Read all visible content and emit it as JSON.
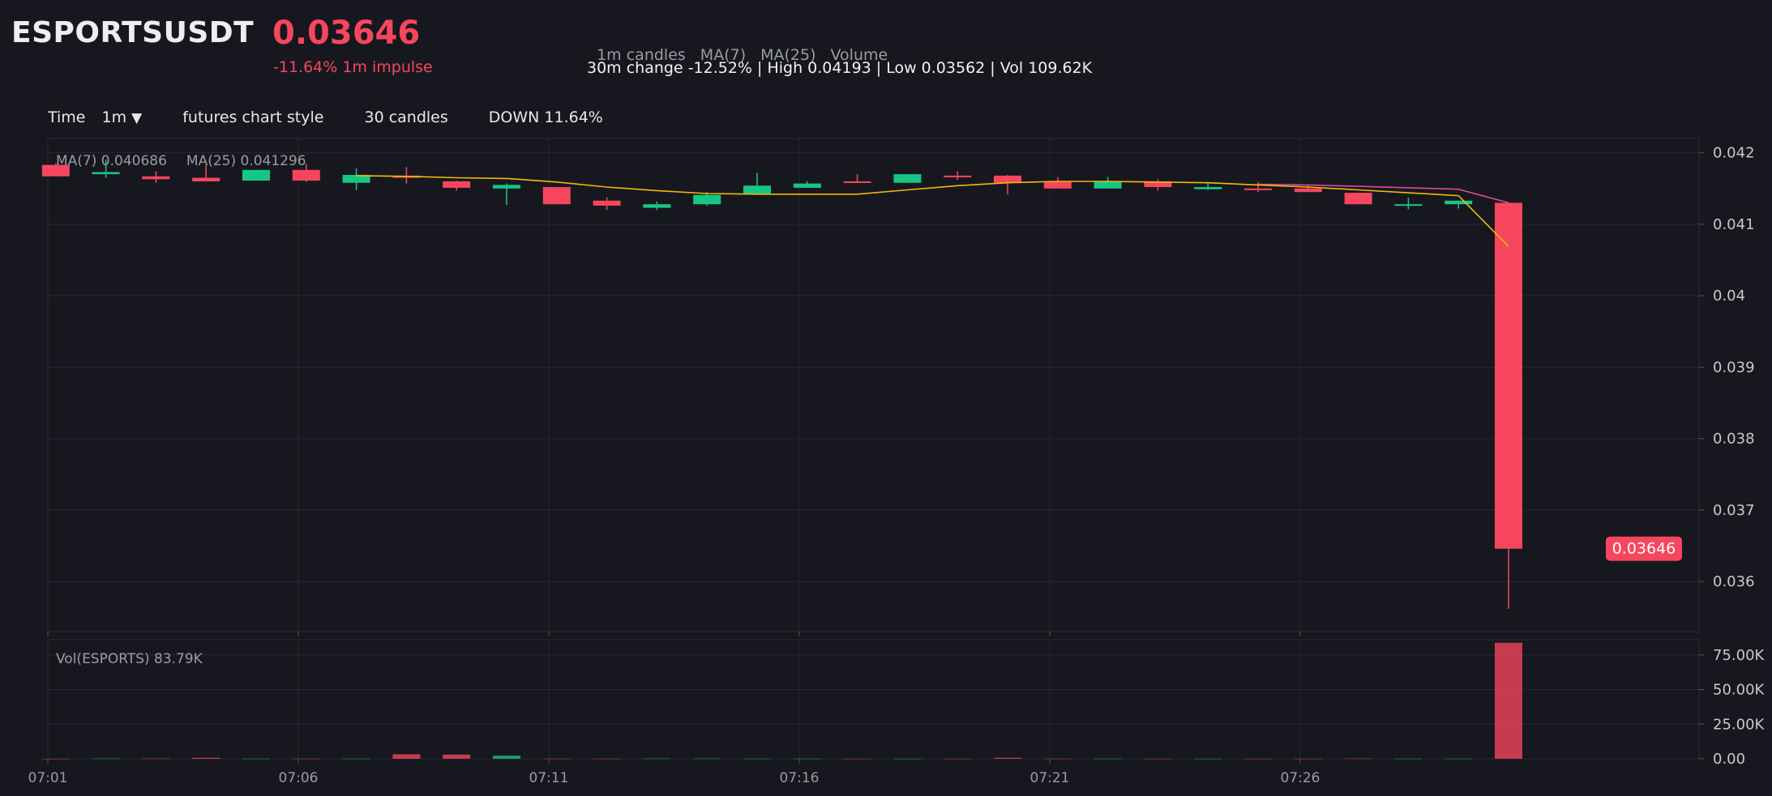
{
  "header": {
    "symbol": "ESPORTSUSDT",
    "price": "0.03646",
    "impulse": "-11.64% 1m impulse",
    "indicators": [
      "1m candles",
      "MA(7)",
      "MA(25)",
      "Volume"
    ],
    "summary": "30m change -12.52% | High 0.04193 | Low 0.03562 | Vol 109.62K"
  },
  "toolbar": {
    "time_label": "Time",
    "interval": "1m",
    "dropdown_glyph": "▼",
    "style_label": "futures chart style",
    "candles_label": "30 candles",
    "direction_label": "DOWN 11.64%"
  },
  "colors": {
    "up": "#16c784",
    "down": "#f6465d",
    "ma7": "#f0b90b",
    "ma25": "#e0489a",
    "background": "#17181f",
    "grid": "#262832",
    "text_muted": "#9a9ca3"
  },
  "chart_data": [
    {
      "type": "candlestick",
      "title": "",
      "legend": [
        {
          "name": "MA(7)",
          "value": "0.040686"
        },
        {
          "name": "MA(25)",
          "value": "0.041296"
        }
      ],
      "x_ticks": [
        "07:01",
        "07:06",
        "07:11",
        "07:16",
        "07:21",
        "07:26"
      ],
      "ylim": [
        0.0353,
        0.0422
      ],
      "y_ticks": [
        "0.036",
        "0.037",
        "0.038",
        "0.039",
        "0.04",
        "0.041",
        "0.042"
      ],
      "last_price_label": "0.03646",
      "grid": true,
      "candles": [
        {
          "t": "07:01",
          "o": 0.04183,
          "h": 0.04185,
          "l": 0.04167,
          "c": 0.04167
        },
        {
          "t": "07:02",
          "o": 0.0417,
          "h": 0.0419,
          "l": 0.04165,
          "c": 0.04173
        },
        {
          "t": "07:03",
          "o": 0.04167,
          "h": 0.04174,
          "l": 0.04158,
          "c": 0.04163
        },
        {
          "t": "07:04",
          "o": 0.04165,
          "h": 0.04183,
          "l": 0.0416,
          "c": 0.0416
        },
        {
          "t": "07:05",
          "o": 0.04161,
          "h": 0.04176,
          "l": 0.04161,
          "c": 0.04176
        },
        {
          "t": "07:06",
          "o": 0.04176,
          "h": 0.04184,
          "l": 0.04159,
          "c": 0.04161
        },
        {
          "t": "07:07",
          "o": 0.04158,
          "h": 0.04178,
          "l": 0.04148,
          "c": 0.04169
        },
        {
          "t": "07:08",
          "o": 0.04168,
          "h": 0.0418,
          "l": 0.04157,
          "c": 0.04165
        },
        {
          "t": "07:09",
          "o": 0.0416,
          "h": 0.04161,
          "l": 0.04147,
          "c": 0.04151
        },
        {
          "t": "07:10",
          "o": 0.0415,
          "h": 0.04157,
          "l": 0.04127,
          "c": 0.04155
        },
        {
          "t": "07:11",
          "o": 0.04152,
          "h": 0.04152,
          "l": 0.04128,
          "c": 0.04128
        },
        {
          "t": "07:12",
          "o": 0.04133,
          "h": 0.04138,
          "l": 0.0412,
          "c": 0.04126
        },
        {
          "t": "07:13",
          "o": 0.04123,
          "h": 0.04132,
          "l": 0.0412,
          "c": 0.04128
        },
        {
          "t": "07:14",
          "o": 0.04128,
          "h": 0.04145,
          "l": 0.04126,
          "c": 0.04141
        },
        {
          "t": "07:15",
          "o": 0.04142,
          "h": 0.04172,
          "l": 0.04142,
          "c": 0.04154
        },
        {
          "t": "07:16",
          "o": 0.04151,
          "h": 0.0416,
          "l": 0.04151,
          "c": 0.04157
        },
        {
          "t": "07:17",
          "o": 0.0416,
          "h": 0.0417,
          "l": 0.04158,
          "c": 0.04159
        },
        {
          "t": "07:18",
          "o": 0.04158,
          "h": 0.0417,
          "l": 0.04158,
          "c": 0.0417
        },
        {
          "t": "07:19",
          "o": 0.04168,
          "h": 0.04174,
          "l": 0.04162,
          "c": 0.04166
        },
        {
          "t": "07:20",
          "o": 0.04168,
          "h": 0.04169,
          "l": 0.04142,
          "c": 0.04158
        },
        {
          "t": "07:21",
          "o": 0.0416,
          "h": 0.04166,
          "l": 0.0415,
          "c": 0.0415
        },
        {
          "t": "07:22",
          "o": 0.0415,
          "h": 0.04166,
          "l": 0.0415,
          "c": 0.0416
        },
        {
          "t": "07:23",
          "o": 0.0416,
          "h": 0.04163,
          "l": 0.04147,
          "c": 0.04152
        },
        {
          "t": "07:24",
          "o": 0.04149,
          "h": 0.04158,
          "l": 0.04148,
          "c": 0.04152
        },
        {
          "t": "07:25",
          "o": 0.0415,
          "h": 0.04159,
          "l": 0.04145,
          "c": 0.04148
        },
        {
          "t": "07:26",
          "o": 0.0415,
          "h": 0.04154,
          "l": 0.04145,
          "c": 0.04145
        },
        {
          "t": "07:27",
          "o": 0.04144,
          "h": 0.04144,
          "l": 0.04128,
          "c": 0.04128
        },
        {
          "t": "07:28",
          "o": 0.04128,
          "h": 0.04137,
          "l": 0.04121,
          "c": 0.04128
        },
        {
          "t": "07:29",
          "o": 0.04128,
          "h": 0.04133,
          "l": 0.04122,
          "c": 0.04133
        },
        {
          "t": "07:30",
          "o": 0.0413,
          "h": 0.0413,
          "l": 0.03562,
          "c": 0.03646
        }
      ],
      "ma7": [
        {
          "t": "07:07",
          "v": 0.04168
        },
        {
          "t": "07:08",
          "v": 0.04167
        },
        {
          "t": "07:09",
          "v": 0.04165
        },
        {
          "t": "07:10",
          "v": 0.04164
        },
        {
          "t": "07:11",
          "v": 0.04159
        },
        {
          "t": "07:12",
          "v": 0.04152
        },
        {
          "t": "07:13",
          "v": 0.04147
        },
        {
          "t": "07:14",
          "v": 0.04143
        },
        {
          "t": "07:15",
          "v": 0.04142
        },
        {
          "t": "07:16",
          "v": 0.04142
        },
        {
          "t": "07:17",
          "v": 0.04142
        },
        {
          "t": "07:18",
          "v": 0.04148
        },
        {
          "t": "07:19",
          "v": 0.04154
        },
        {
          "t": "07:20",
          "v": 0.04158
        },
        {
          "t": "07:21",
          "v": 0.0416
        },
        {
          "t": "07:22",
          "v": 0.0416
        },
        {
          "t": "07:23",
          "v": 0.04159
        },
        {
          "t": "07:24",
          "v": 0.04158
        },
        {
          "t": "07:25",
          "v": 0.04155
        },
        {
          "t": "07:26",
          "v": 0.04152
        },
        {
          "t": "07:27",
          "v": 0.04148
        },
        {
          "t": "07:28",
          "v": 0.04144
        },
        {
          "t": "07:29",
          "v": 0.0414
        },
        {
          "t": "07:30",
          "v": 0.04069
        }
      ],
      "ma25": [
        {
          "t": "07:25",
          "v": 0.04156
        },
        {
          "t": "07:26",
          "v": 0.04155
        },
        {
          "t": "07:27",
          "v": 0.04153
        },
        {
          "t": "07:28",
          "v": 0.04151
        },
        {
          "t": "07:29",
          "v": 0.04149
        },
        {
          "t": "07:30",
          "v": 0.0413
        }
      ]
    },
    {
      "type": "bar",
      "title": "",
      "legend_label": "Vol(ESPORTS) 83.79K",
      "x_ticks": [
        "07:01",
        "07:06",
        "07:11",
        "07:16",
        "07:21",
        "07:26"
      ],
      "ylim": [
        0,
        86000
      ],
      "y_ticks": [
        "0.00",
        "25.00K",
        "50.00K",
        "75.00K"
      ],
      "y_tick_values": [
        0,
        25000,
        50000,
        75000
      ],
      "bars": [
        {
          "t": "07:01",
          "v": 0,
          "dir": "down"
        },
        {
          "t": "07:02",
          "v": 150,
          "dir": "up"
        },
        {
          "t": "07:03",
          "v": 150,
          "dir": "down"
        },
        {
          "t": "07:04",
          "v": 700,
          "dir": "down"
        },
        {
          "t": "07:05",
          "v": 100,
          "dir": "up"
        },
        {
          "t": "07:06",
          "v": 100,
          "dir": "down"
        },
        {
          "t": "07:07",
          "v": 100,
          "dir": "up"
        },
        {
          "t": "07:08",
          "v": 3200,
          "dir": "down"
        },
        {
          "t": "07:09",
          "v": 3000,
          "dir": "down"
        },
        {
          "t": "07:10",
          "v": 2200,
          "dir": "up"
        },
        {
          "t": "07:11",
          "v": 100,
          "dir": "down"
        },
        {
          "t": "07:12",
          "v": 100,
          "dir": "down"
        },
        {
          "t": "07:13",
          "v": 150,
          "dir": "up"
        },
        {
          "t": "07:14",
          "v": 150,
          "dir": "up"
        },
        {
          "t": "07:15",
          "v": 100,
          "dir": "up"
        },
        {
          "t": "07:16",
          "v": 100,
          "dir": "up"
        },
        {
          "t": "07:17",
          "v": 50,
          "dir": "down"
        },
        {
          "t": "07:18",
          "v": 50,
          "dir": "up"
        },
        {
          "t": "07:19",
          "v": 50,
          "dir": "down"
        },
        {
          "t": "07:20",
          "v": 700,
          "dir": "down"
        },
        {
          "t": "07:21",
          "v": 100,
          "dir": "down"
        },
        {
          "t": "07:22",
          "v": 100,
          "dir": "up"
        },
        {
          "t": "07:23",
          "v": 50,
          "dir": "down"
        },
        {
          "t": "07:24",
          "v": 50,
          "dir": "up"
        },
        {
          "t": "07:25",
          "v": 50,
          "dir": "down"
        },
        {
          "t": "07:26",
          "v": 50,
          "dir": "down"
        },
        {
          "t": "07:27",
          "v": 150,
          "dir": "down"
        },
        {
          "t": "07:28",
          "v": 100,
          "dir": "up"
        },
        {
          "t": "07:29",
          "v": 100,
          "dir": "up"
        },
        {
          "t": "07:30",
          "v": 83790,
          "dir": "down"
        }
      ]
    }
  ]
}
